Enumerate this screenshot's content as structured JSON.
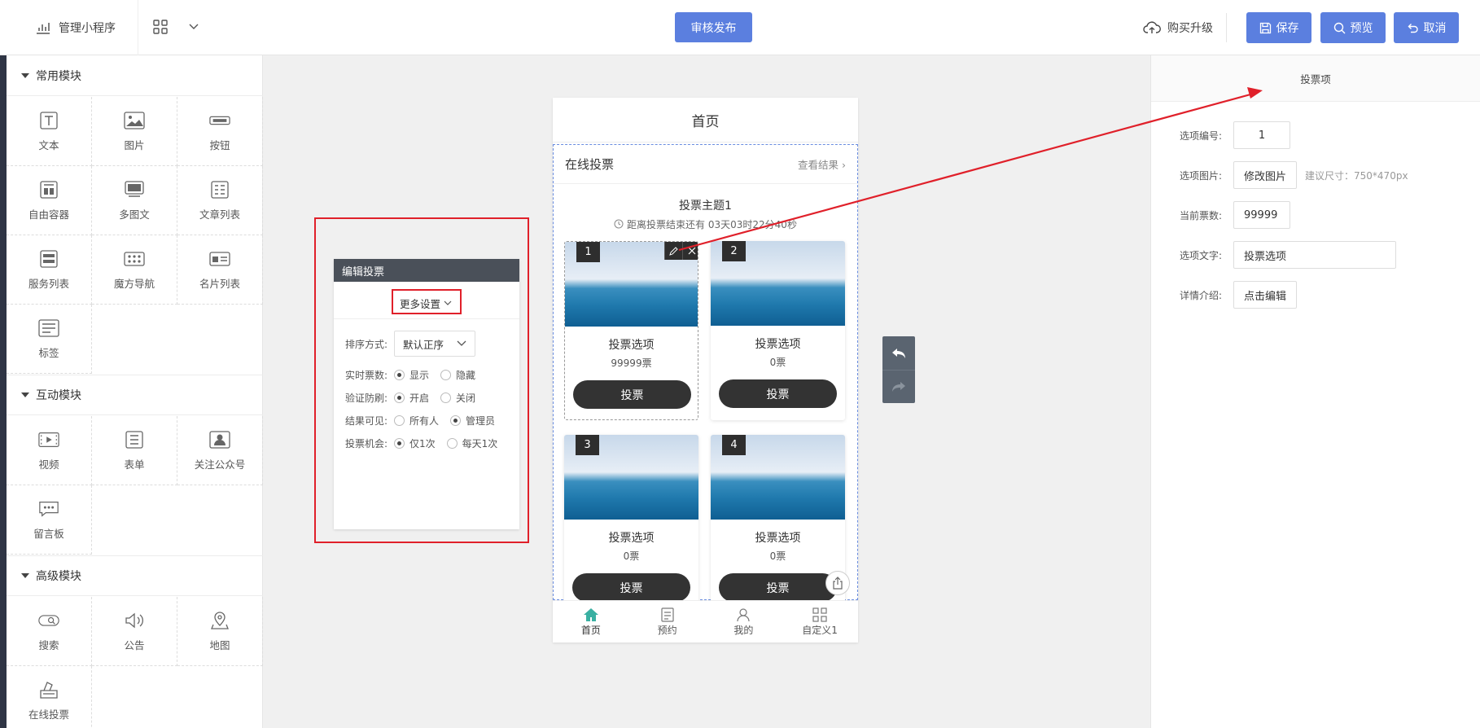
{
  "topbar": {
    "brand_label": "管理小程序",
    "publish_label": "审核发布",
    "buy_label": "购买升级",
    "save_label": "保存",
    "preview_label": "预览",
    "cancel_label": "取消"
  },
  "left_panel": {
    "sections": [
      {
        "title": "常用模块",
        "items": [
          "文本",
          "图片",
          "按钮",
          "自由容器",
          "多图文",
          "文章列表",
          "服务列表",
          "魔方导航",
          "名片列表",
          "标签"
        ]
      },
      {
        "title": "互动模块",
        "items": [
          "视频",
          "表单",
          "关注公众号",
          "留言板"
        ]
      },
      {
        "title": "高级模块",
        "items": [
          "搜索",
          "公告",
          "地图",
          "在线投票"
        ]
      }
    ]
  },
  "edit_panel": {
    "title": "编辑投票",
    "more_settings": "更多设置",
    "sort_label": "排序方式:",
    "sort_value": "默认正序",
    "realtime_label": "实时票数:",
    "realtime_options": [
      "显示",
      "隐藏"
    ],
    "verify_label": "验证防刷:",
    "verify_options": [
      "开启",
      "关闭"
    ],
    "result_label": "结果可见:",
    "result_options": [
      "所有人",
      "管理员"
    ],
    "chance_label": "投票机会:",
    "chance_options": [
      "仅1次",
      "每天1次"
    ]
  },
  "phone": {
    "page_title": "首页",
    "module_title": "在线投票",
    "view_result": "查看结果",
    "topic": "投票主题1",
    "countdown": "距离投票结束还有 03天03时22分40秒",
    "cards": [
      {
        "num": "1",
        "name": "投票选项",
        "count": "99999票",
        "button": "投票"
      },
      {
        "num": "2",
        "name": "投票选项",
        "count": "0票",
        "button": "投票"
      },
      {
        "num": "3",
        "name": "投票选项",
        "count": "0票",
        "button": "投票"
      },
      {
        "num": "4",
        "name": "投票选项",
        "count": "0票",
        "button": "投票"
      }
    ],
    "tabs": [
      "首页",
      "预约",
      "我的",
      "自定义1"
    ]
  },
  "right_panel": {
    "title": "投票项",
    "option_num_label": "选项编号:",
    "option_num_value": "1",
    "option_image_label": "选项图片:",
    "option_image_button": "修改图片",
    "option_image_hint": "建议尺寸：750*470px",
    "votes_label": "当前票数:",
    "votes_value": "99999",
    "text_label": "选项文字:",
    "text_value": "投票选项",
    "detail_label": "详情介绍:",
    "detail_button": "点击编辑"
  },
  "colors": {
    "accent": "#5b7fdf",
    "annotation_red": "#e0202a",
    "dark_sidebar": "#2f3545"
  }
}
